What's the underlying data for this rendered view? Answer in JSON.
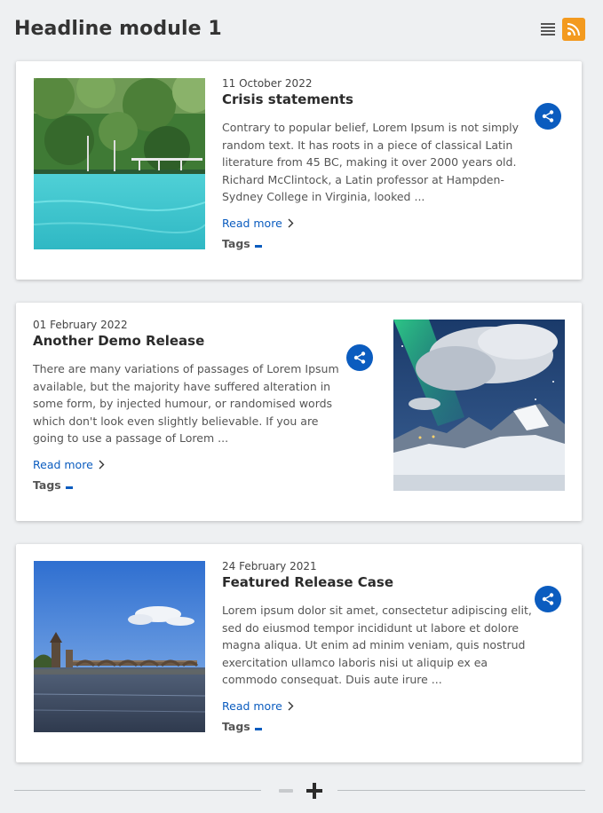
{
  "module": {
    "title": "Headline module 1"
  },
  "toolbar": {
    "list_view_icon": "list-icon",
    "rss_icon": "rss-icon",
    "rss_color": "#f39a1f"
  },
  "accent": "#0b5cbf",
  "articles": [
    {
      "date": "11 October 2022",
      "title": "Crisis statements",
      "excerpt": "Contrary to popular belief, Lorem Ipsum is not simply random text. It has roots in a piece of classical Latin literature from 45 BC, making it over 2000 years old. Richard McClintock, a Latin professor at Hampden-Sydney College in Virginia, looked ...",
      "read_more": "Read more",
      "tags_label": "Tags",
      "image": "turquoise river with green forest and wooden bridge"
    },
    {
      "date": "01 February 2022",
      "title": "Another Demo Release",
      "excerpt": "There are many variations of passages of Lorem Ipsum available, but the majority have suffered alteration in some form, by injected humour, or randomised words which don't look even slightly believable. If you are going to use a passage of Lorem ...",
      "read_more": "Read more",
      "tags_label": "Tags",
      "image": "northern lights over snowy mountains"
    },
    {
      "date": "24 February 2021",
      "title": "Featured Release Case",
      "excerpt": "Lorem ipsum dolor sit amet, consectetur adipiscing elit, sed do eiusmod tempor incididunt ut labore et dolore magna aliqua. Ut enim ad minim veniam, quis nostrud exercitation ullamco laboris nisi ut aliquip ex ea commodo consequat. Duis aute irure ...",
      "read_more": "Read more",
      "tags_label": "Tags",
      "image": "stone bridge over river under blue sky"
    }
  ]
}
